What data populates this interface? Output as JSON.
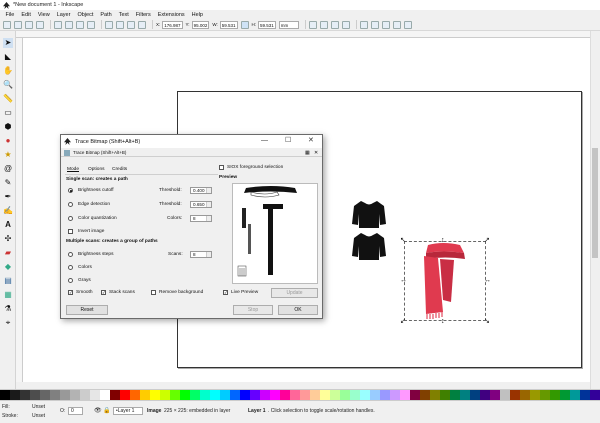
{
  "window": {
    "title": "*New document 1 - Inkscape"
  },
  "menu": [
    "File",
    "Edit",
    "View",
    "Layer",
    "Object",
    "Path",
    "Text",
    "Filters",
    "Extensions",
    "Help"
  ],
  "toolbar": {
    "x_label": "X:",
    "x_value": "176.987",
    "y_label": "Y:",
    "y_value": "95.002",
    "w_label": "W:",
    "w_value": "59.531",
    "h_label": "H:",
    "h_value": "59.531",
    "unit": "mm"
  },
  "dialog": {
    "title": "Trace Bitmap (Shift+Alt+B)",
    "subtitle": "Trace Bitmap (Shift+Alt+B)",
    "tabs": [
      "Mode",
      "Options",
      "Credits"
    ],
    "sioxLabel": "SIOX foreground selection",
    "previewLabel": "Preview",
    "singleScanHeading": "Single scan: creates a path",
    "brightnessCutoff": "Brightness cutoff",
    "edgeDetection": "Edge detection",
    "colorQuantization": "Color quantization",
    "invertImage": "Invert image",
    "thresholdLabel": "Threshold:",
    "thresholdValue1": "0.400",
    "thresholdValue2": "0.650",
    "colorsLabel": "Colors:",
    "colorsValue": "8",
    "multiScanHeading": "Multiple scans: creates a group of paths",
    "brightnessSteps": "Brightness steps",
    "colors": "Colors",
    "grays": "Grays",
    "scansLabel": "Scans:",
    "scansValue": "8",
    "smooth": "Smooth",
    "stackScans": "Stack scans",
    "removeBackground": "Remove background",
    "livePreview": "Live Preview",
    "updateButton": "Update",
    "resetButton": "Reset",
    "stopButton": "Stop",
    "okButton": "OK"
  },
  "status": {
    "fillLabel": "Fill:",
    "fillValue": "Unset",
    "strokeLabel": "Stroke:",
    "strokeValue": "Unset",
    "opacityLabel": "O:",
    "opacityValue": "0",
    "layer": "•Layer 1",
    "messagePrefix": "Image",
    "messageBody": "225 × 225: embedded in layer",
    "layerName": "Layer 1",
    "messageSuffix": ". Click selection to toggle scale/rotation handles."
  },
  "colors": {
    "scarf": "#e03a4f",
    "scarfDark": "#b8283b",
    "sweater": "#111111",
    "palette": [
      "#000000",
      "#1a1a1a",
      "#333333",
      "#4d4d4d",
      "#666666",
      "#808080",
      "#999999",
      "#b3b3b3",
      "#cccccc",
      "#e6e6e6",
      "#ffffff",
      "#800000",
      "#ff0000",
      "#ff6600",
      "#ffcc00",
      "#ffff00",
      "#ccff00",
      "#66ff00",
      "#00ff00",
      "#00ff66",
      "#00ffcc",
      "#00ffff",
      "#00ccff",
      "#0066ff",
      "#0000ff",
      "#6600ff",
      "#cc00ff",
      "#ff00ff",
      "#ff0099",
      "#ff6699",
      "#ff9999",
      "#ffcc99",
      "#ffff99",
      "#ccff99",
      "#99ff99",
      "#99ffcc",
      "#99ffff",
      "#99ccff",
      "#9999ff",
      "#cc99ff",
      "#ff99ff",
      "#800040",
      "#804000",
      "#808000",
      "#408000",
      "#008040",
      "#008080",
      "#004080",
      "#400080",
      "#800080",
      "#c0c0c0",
      "#993300",
      "#996600",
      "#999900",
      "#669900",
      "#339900",
      "#009933",
      "#009999",
      "#003399",
      "#330099"
    ]
  }
}
